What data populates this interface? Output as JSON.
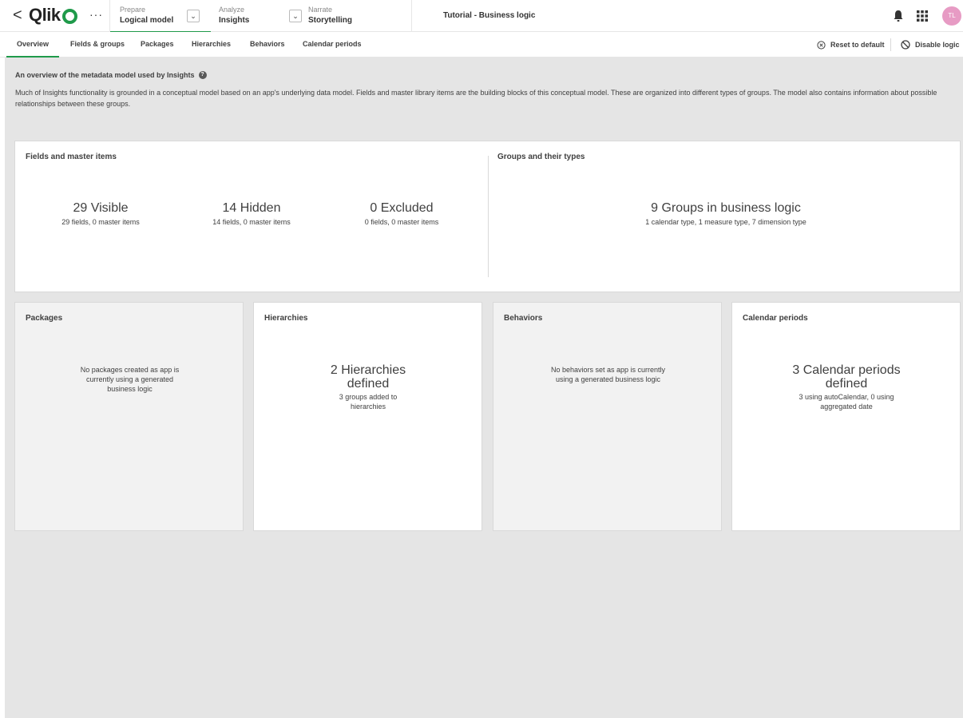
{
  "topbar": {
    "back_glyph": "<",
    "logo_text": "Qlik",
    "more_glyph": "···",
    "stages": [
      {
        "caption": "Prepare",
        "name": "Logical model"
      },
      {
        "caption": "Analyze",
        "name": "Insights"
      },
      {
        "caption": "Narrate",
        "name": "Storytelling"
      }
    ],
    "app_title": "Tutorial - Business logic",
    "avatar_initials": "TL",
    "icons": [
      "back-icon",
      "more-icon",
      "chevron-down-icon",
      "bell-icon",
      "grid-menu-icon"
    ],
    "accent_color": "#1f9a4a",
    "avatar_color": "#e79bc4"
  },
  "tabs": [
    {
      "label": "Overview",
      "active": true
    },
    {
      "label": "Fields & groups"
    },
    {
      "label": "Packages"
    },
    {
      "label": "Hierarchies"
    },
    {
      "label": "Behaviors"
    },
    {
      "label": "Calendar periods"
    }
  ],
  "toolbar": {
    "reset_label": "Reset to default",
    "disable_label": "Disable logic"
  },
  "intro": {
    "title": "An overview of the metadata model used by Insights",
    "text": "Much of Insights functionality is grounded in a conceptual model based on an app's underlying data model. Fields and master library items are the building blocks of this conceptual model. These are organized into different types of groups. The model also contains information about possible relationships between these groups."
  },
  "fields_card": {
    "title": "Fields and master items",
    "visible": {
      "big": "29 Visible",
      "small": "29 fields, 0 master items"
    },
    "hidden": {
      "big": "14 Hidden",
      "small": "14 fields, 0 master items"
    },
    "excluded": {
      "big": "0 Excluded",
      "small": "0 fields, 0 master items"
    }
  },
  "groups_card": {
    "title": "Groups and their types",
    "big": "9 Groups in business logic",
    "small": "1 calendar type, 1 measure type, 7 dimension type"
  },
  "packages_card": {
    "title": "Packages",
    "message": "No packages created as app is currently using a generated business logic"
  },
  "hierarchies_card": {
    "title": "Hierarchies",
    "big": "2 Hierarchies defined",
    "small": "3 groups added to hierarchies"
  },
  "behaviors_card": {
    "title": "Behaviors",
    "message": "No behaviors set as app is currently using a generated business logic"
  },
  "calendar_card": {
    "title": "Calendar periods",
    "big": "3 Calendar periods defined",
    "small": "3 using autoCalendar, 0 using aggregated date"
  }
}
